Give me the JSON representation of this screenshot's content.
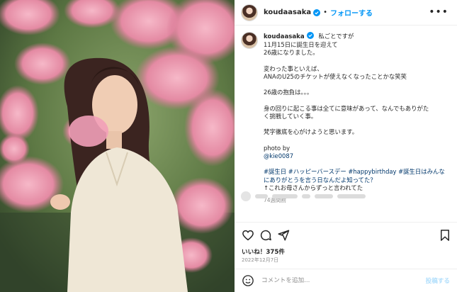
{
  "header": {
    "username": "koudaasaka",
    "separator": "•",
    "follow_label": "フォローする",
    "more_icon": "more-horizontal-icon"
  },
  "caption": {
    "username": "koudaasaka",
    "lines": [
      "私ごとですが",
      "11月15日に誕生日を迎えて",
      "26歳になりました。",
      "",
      "変わった事といえば、",
      "ANAのU25のチケットが使えなくなったことかな笑笑",
      "",
      "26歳の抱負は。。。",
      "",
      "身の回りに起こる事は全てに意味があって、なんでもありがた",
      "く挑戦していく事。",
      "",
      "梵字徹底を心がけようと思います。",
      "",
      "photo by"
    ],
    "photo_credit": "@kie0087",
    "hashtag_lines": [
      "#誕生日 #ハッピーバースデー #happybirthday #誕生日はみんな",
      "にありがとうを言う日なんだよ知ってた？"
    ],
    "tail_line": "↑これお母さんからずっと言われてた",
    "time_ago": "74週間前"
  },
  "actions": {
    "like_icon": "heart-icon",
    "comment_icon": "comment-icon",
    "share_icon": "share-icon",
    "save_icon": "bookmark-icon"
  },
  "likes_text": "いいね！375件",
  "date_text": "2022年12月7日",
  "comment_box": {
    "emoji_icon": "emoji-icon",
    "placeholder": "コメントを追加...",
    "post_label": "投稿する"
  },
  "colors": {
    "accent": "#0095f6",
    "link": "#00376b",
    "muted": "#8e8e8e",
    "blossom": "#e98aa6"
  }
}
